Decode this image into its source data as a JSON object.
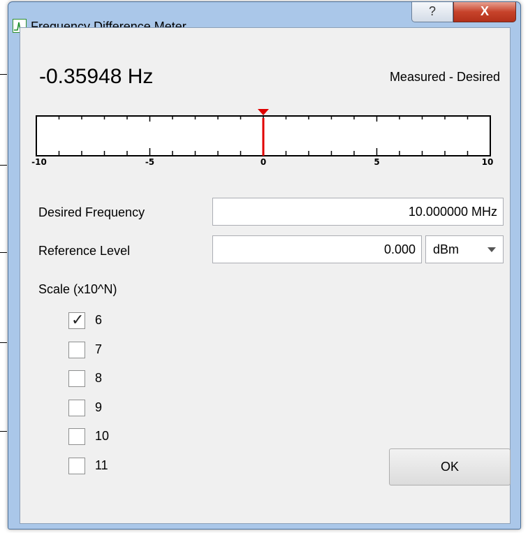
{
  "window": {
    "title": "Frequency Difference Meter",
    "help_glyph": "?",
    "close_glyph": "X"
  },
  "reading": {
    "value": "-0.35948 Hz",
    "mode_label": "Measured - Desired"
  },
  "meter": {
    "min": -10,
    "max": 10,
    "needle_value": 0,
    "tick_labels": [
      "-10",
      "-5",
      "0",
      "5",
      "10"
    ],
    "needle_color": "#e00000"
  },
  "desired_frequency": {
    "label": "Desired Frequency",
    "value": "10.000000 MHz"
  },
  "reference_level": {
    "label": "Reference Level",
    "value": "0.000",
    "unit": "dBm"
  },
  "scale": {
    "label": "Scale (x10^N)",
    "options": [
      {
        "label": "6",
        "checked": true
      },
      {
        "label": "7",
        "checked": false
      },
      {
        "label": "8",
        "checked": false
      },
      {
        "label": "9",
        "checked": false
      },
      {
        "label": "10",
        "checked": false
      },
      {
        "label": "11",
        "checked": false
      }
    ]
  },
  "ok_label": "OK"
}
